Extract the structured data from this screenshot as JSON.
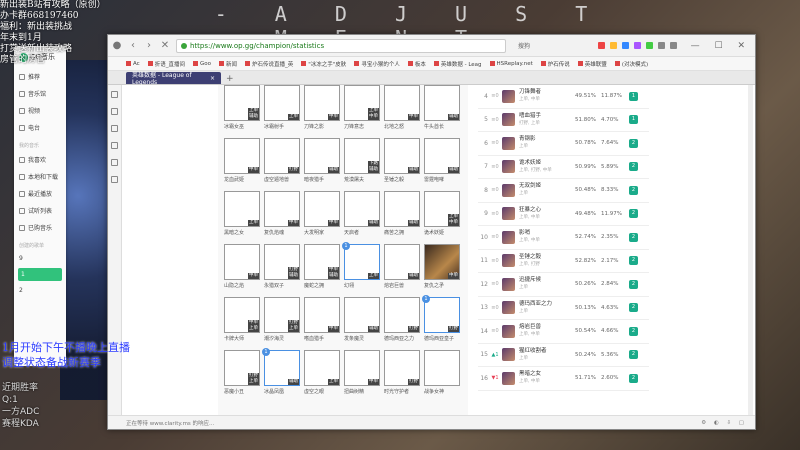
{
  "overlay": {
    "banner": "- A D J U S T M E N T -",
    "top_lines": [
      "新出装B站有攻略（原创）",
      "办卡群668197460",
      "福利：新出装挑战",
      "年末到1月",
      "打赏送新出装攻略",
      "房管的房管"
    ],
    "bottom_lines": [
      "1月开始下午不播晚上直播",
      "调整状态备战新赛季"
    ],
    "stats": [
      "近期胜率",
      "Q:1",
      "一方ADC",
      "赛程KDA"
    ]
  },
  "music": {
    "app_name": "QQ音乐",
    "items": [
      "推荐",
      "音乐馆",
      "视频",
      "电台"
    ],
    "section_mine": "我的音乐",
    "mine_items": [
      "我喜欢",
      "本地和下载",
      "最近播放",
      "试听列表",
      "已购音乐"
    ],
    "section_created": "创建的歌单",
    "playlists": [
      "9",
      "1",
      "2"
    ]
  },
  "browser": {
    "url": "https://www.op.gg/champion/statistics",
    "search_label": "搜狗",
    "window_controls": "— ☐ ✕",
    "bookmarks": [
      "Ac",
      "折语_直播间",
      "Goo",
      "新闻",
      "炉石传说直播_英",
      "\"冰冻之手\"皮肤",
      "寻宝小猴的个人",
      "板本",
      "英雄数据 - Leag",
      "HSReplay.net",
      "炉石传说",
      "英雄联盟",
      "(对决模式)"
    ],
    "tab_title": "英雄数据 - League of Legends",
    "tab_add": "+",
    "status_text": "正在等待 www.clarity.ms 的响应..."
  },
  "champions": [
    {
      "name": "冰霜女巫",
      "role": "上单\n辅助",
      "badge": ""
    },
    {
      "name": "冰霜射手",
      "role": "上单",
      "badge": ""
    },
    {
      "name": "刀锋之影",
      "role": "中单",
      "badge": ""
    },
    {
      "name": "刀锋意志",
      "role": "上单\n中单",
      "badge": ""
    },
    {
      "name": "北地之怒",
      "role": "中单",
      "badge": ""
    },
    {
      "name": "牛头酋长",
      "role": "辅助",
      "badge": ""
    },
    {
      "name": "龙血武姬",
      "role": "中单",
      "badge": ""
    },
    {
      "name": "虚空遁地兽",
      "role": "打野",
      "badge": ""
    },
    {
      "name": "暗夜猎手",
      "role": "辅助",
      "badge": ""
    },
    {
      "name": "荒漠屠夫",
      "role": "下路\n辅助",
      "badge": ""
    },
    {
      "name": "圣锤之毅",
      "role": "辅助",
      "badge": ""
    },
    {
      "name": "雷霆咆哮",
      "role": "辅助",
      "badge": ""
    },
    {
      "name": "黑暗之女",
      "role": "上单",
      "badge": ""
    },
    {
      "name": "复仇焰魂",
      "role": "中单",
      "badge": ""
    },
    {
      "name": "大发明家",
      "role": "中单",
      "badge": ""
    },
    {
      "name": "天启者",
      "role": "辅助",
      "badge": ""
    },
    {
      "name": "痛苦之拥",
      "role": "辅助",
      "badge": ""
    },
    {
      "name": "诡术妖姬",
      "role": "上单\n中单",
      "badge": ""
    },
    {
      "name": "山隐之焰",
      "role": "中单",
      "badge": ""
    },
    {
      "name": "永猎双子",
      "role": "打野\n辅助",
      "badge": ""
    },
    {
      "name": "魔蛇之拥",
      "role": "中单\n辅助",
      "badge": ""
    },
    {
      "name": "幻翎",
      "role": "上单",
      "badge": "1"
    },
    {
      "name": "熔岩巨兽",
      "role": "辅助",
      "badge": ""
    },
    {
      "name": "复仇之矛",
      "role": "中单",
      "badge": ""
    },
    {
      "name": "卡牌大师",
      "role": "中单\n上单",
      "badge": ""
    },
    {
      "name": "潮汐海灵",
      "role": "打野\n上单",
      "badge": ""
    },
    {
      "name": "嗜血猎手",
      "role": "中单",
      "badge": ""
    },
    {
      "name": "发条魔灵",
      "role": "辅助",
      "badge": ""
    },
    {
      "name": "德玛西亚之力",
      "role": "打野",
      "badge": ""
    },
    {
      "name": "德玛西亚皇子",
      "role": "打野",
      "badge": "1"
    },
    {
      "name": "恶魔小丑",
      "role": "打野\n上单",
      "badge": ""
    },
    {
      "name": "冰晶凤凰",
      "role": "辅助",
      "badge": "1"
    },
    {
      "name": "虚空之眼",
      "role": "上单",
      "badge": ""
    },
    {
      "name": "扭曲树精",
      "role": "中单",
      "badge": ""
    },
    {
      "name": "时光守护者",
      "role": "打野",
      "badge": ""
    },
    {
      "name": "战争女神",
      "role": "",
      "badge": ""
    }
  ],
  "rankings": [
    {
      "rank": "4",
      "trend": "0",
      "dir": "flat",
      "name": "刀锋舞者",
      "pos": "上单, 中单",
      "wr": "49.51%",
      "pr": "11.87%",
      "tier": "1"
    },
    {
      "rank": "5",
      "trend": "0",
      "dir": "flat",
      "name": "嗜血猎手",
      "pos": "打野, 上单",
      "wr": "51.80%",
      "pr": "4.70%",
      "tier": "1"
    },
    {
      "rank": "6",
      "trend": "0",
      "dir": "flat",
      "name": "青钢影",
      "pos": "上单",
      "wr": "50.78%",
      "pr": "7.64%",
      "tier": "2"
    },
    {
      "rank": "7",
      "trend": "0",
      "dir": "flat",
      "name": "诡术妖姬",
      "pos": "上单, 打野, 中单",
      "wr": "50.99%",
      "pr": "5.89%",
      "tier": "2"
    },
    {
      "rank": "8",
      "trend": "0",
      "dir": "flat",
      "name": "无双剑姬",
      "pos": "上单",
      "wr": "50.48%",
      "pr": "8.33%",
      "tier": "2"
    },
    {
      "rank": "9",
      "trend": "0",
      "dir": "flat",
      "name": "狂暴之心",
      "pos": "上单, 中单",
      "wr": "49.48%",
      "pr": "11.97%",
      "tier": "2"
    },
    {
      "rank": "10",
      "trend": "0",
      "dir": "flat",
      "name": "影哨",
      "pos": "上单, 中单",
      "wr": "52.74%",
      "pr": "2.35%",
      "tier": "2"
    },
    {
      "rank": "11",
      "trend": "0",
      "dir": "flat",
      "name": "圣锤之毅",
      "pos": "上单, 打野",
      "wr": "52.82%",
      "pr": "2.17%",
      "tier": "2"
    },
    {
      "rank": "12",
      "trend": "0",
      "dir": "flat",
      "name": "迅捷斥候",
      "pos": "上单",
      "wr": "50.26%",
      "pr": "2.84%",
      "tier": "2"
    },
    {
      "rank": "13",
      "trend": "0",
      "dir": "flat",
      "name": "德玛西亚之力",
      "pos": "上单",
      "wr": "50.13%",
      "pr": "4.63%",
      "tier": "2"
    },
    {
      "rank": "14",
      "trend": "0",
      "dir": "flat",
      "name": "熔岩巨兽",
      "pos": "上单, 中单",
      "wr": "50.54%",
      "pr": "4.66%",
      "tier": "2"
    },
    {
      "rank": "15",
      "trend": "1",
      "dir": "up",
      "name": "猩红收割者",
      "pos": "上单",
      "wr": "50.24%",
      "pr": "5.36%",
      "tier": "2"
    },
    {
      "rank": "16",
      "trend": "1",
      "dir": "down",
      "name": "黑暗之女",
      "pos": "上单, 中单",
      "wr": "51.71%",
      "pr": "2.60%",
      "tier": "2"
    }
  ]
}
